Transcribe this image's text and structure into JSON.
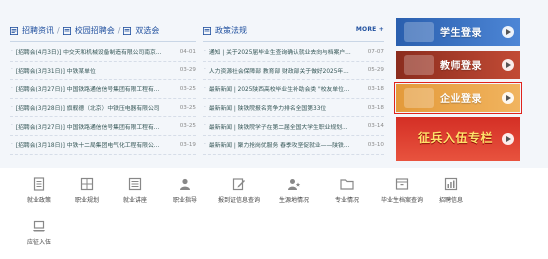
{
  "recruit": {
    "tabs": [
      "招聘资讯",
      "校园招聘会",
      "双选会"
    ],
    "items": [
      {
        "title": "[招聘会(4月3日)] 中交天和机械设备制造有限公司南京...",
        "date": "04-01"
      },
      {
        "title": "[招聘会(3月31日)] 中铁某单位",
        "date": "03-29"
      },
      {
        "title": "[招聘会(3月27日)] 中国铁路通信信号集团有限工程有...",
        "date": "03-25"
      },
      {
        "title": "[招聘会(3月28日)] 旗舰德（北京）中铁压电器有限公司",
        "date": "03-25"
      },
      {
        "title": "[招聘会(3月27日)] 中国铁路通信信号集团有限工程有...",
        "date": "03-25"
      },
      {
        "title": "[招聘会(3月18日)] 中铁十二局集团电气化工程有限公...",
        "date": "03-19"
      }
    ]
  },
  "policy": {
    "title": "政策法规",
    "more": "MORE +",
    "items": [
      {
        "title": "通知 | 关于2025届毕业生查询确认就业去向与档案户...",
        "date": "07-07"
      },
      {
        "title": "人力资源社会保障部 教育部 财政部关于做好2025年...",
        "date": "05-29"
      },
      {
        "title": "最新新闻 | 2025陕西高校毕业生补助会类 \"校友单位...",
        "date": "03-18"
      },
      {
        "title": "最新新闻 | 陕铁院报名竞争力排名全国第33位",
        "date": "03-18"
      },
      {
        "title": "最新新闻 | 陕铁院学子在第二届全国大学生职业规划...",
        "date": "03-14"
      },
      {
        "title": "最新新闻 | 聚力抢岗优服务 春季攻坚促就业——陕铁...",
        "date": "03-10"
      }
    ]
  },
  "banners": [
    "学生登录",
    "教师登录",
    "企业登录",
    "征兵入伍专栏"
  ],
  "quick_links": [
    {
      "label": "就业政策",
      "icon": "document-icon"
    },
    {
      "label": "职业规划",
      "icon": "grid-icon"
    },
    {
      "label": "就业讲座",
      "icon": "list-icon"
    },
    {
      "label": "职业指导",
      "icon": "person-icon"
    },
    {
      "label": "报到证信息查询",
      "icon": "edit-icon"
    },
    {
      "label": "生源地情况",
      "icon": "star-person-icon"
    },
    {
      "label": "专业情况",
      "icon": "folder-icon"
    },
    {
      "label": "毕业生档案查询",
      "icon": "archive-icon"
    },
    {
      "label": "招聘信息",
      "icon": "chart-icon"
    },
    {
      "label": "应征入伍",
      "icon": "laptop-icon"
    }
  ]
}
